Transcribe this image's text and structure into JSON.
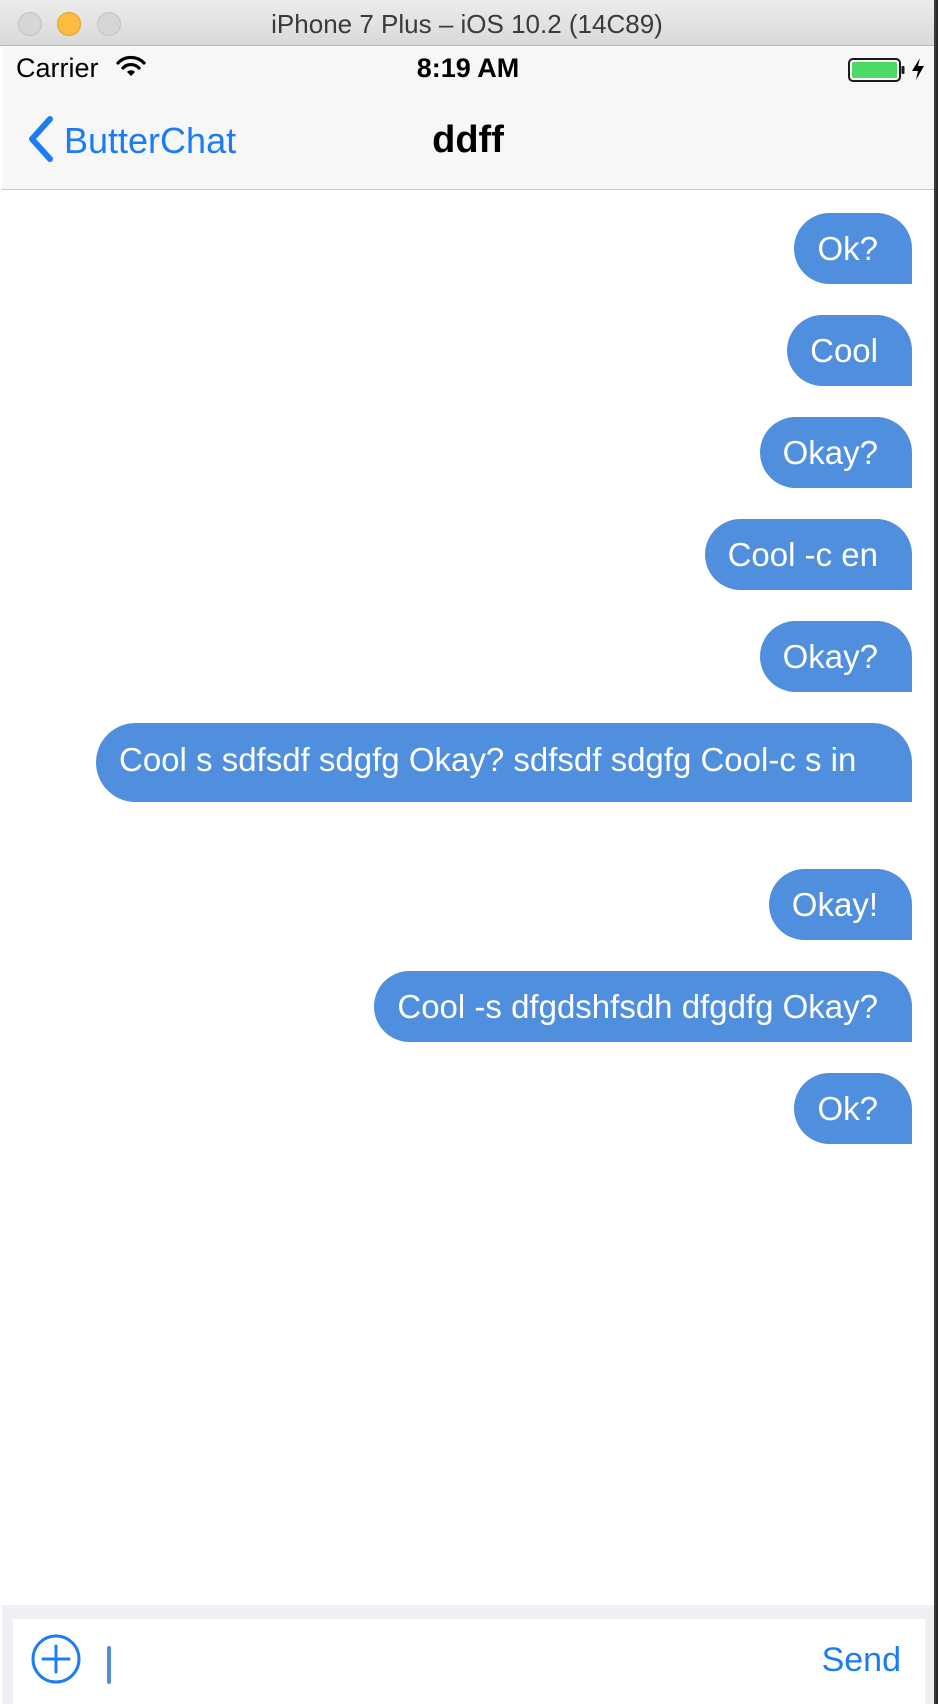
{
  "window": {
    "title": "iPhone 7 Plus – iOS 10.2 (14C89)"
  },
  "status_bar": {
    "carrier": "Carrier",
    "time": "8:19 AM",
    "wifi_icon": "wifi-icon",
    "battery_icon": "battery-icon",
    "charging_icon": "charging-bolt-icon",
    "battery_level": 1.0,
    "battery_color": "#4cd964"
  },
  "nav_bar": {
    "back_label": "ButterChat",
    "back_icon": "chevron-left-icon",
    "title": "ddff"
  },
  "messages": [
    {
      "text": "Ok?",
      "outgoing": true
    },
    {
      "text": "Cool",
      "outgoing": true
    },
    {
      "text": "Okay?",
      "outgoing": true
    },
    {
      "text": "Cool -c en",
      "outgoing": true
    },
    {
      "text": "Okay?",
      "outgoing": true
    },
    {
      "text": "Cool s sdfsdf sdgfg Okay? sdfsdf sdgfg Cool-c s in",
      "outgoing": true
    },
    {
      "text": "Okay!",
      "outgoing": true
    },
    {
      "text": "Cool -s dfgdshfsdh dfgdfg Okay?",
      "outgoing": true
    },
    {
      "text": "Ok?",
      "outgoing": true
    }
  ],
  "input_bar": {
    "add_icon": "plus-circle-icon",
    "value": "",
    "send_label": "Send"
  },
  "colors": {
    "accent": "#1b7cf5",
    "bubble": "#4f8fdd",
    "bubble_text": "#ffffff"
  }
}
